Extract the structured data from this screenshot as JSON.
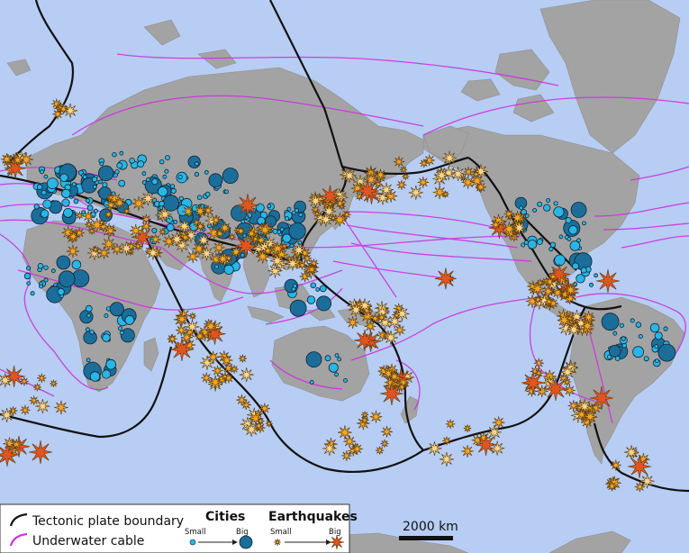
{
  "legend": {
    "boundary_label": "Tectonic plate boundary",
    "cable_label": "Underwater cable",
    "cities_title": "Cities",
    "cities_small": "Small",
    "cities_big": "Big",
    "quakes_title": "Earthquakes",
    "quakes_small": "Small",
    "quakes_big": "Big"
  },
  "scale_bar": {
    "label": "2000 km"
  },
  "colors": {
    "ocean": "#b7cdf3",
    "land": "#a3a3a3",
    "boundary": "#111111",
    "cable": "#cc33dd",
    "city": "#29b6e6",
    "city_big": "#1b6e9a",
    "quake_small": "#f5a623",
    "quake_mid": "#f7d58a",
    "quake_big": "#e2541f"
  },
  "icons": [
    "tectonic-boundary-line-icon",
    "cable-line-icon",
    "city-circle-icon",
    "earthquake-star-icon",
    "scale-bar-icon"
  ]
}
